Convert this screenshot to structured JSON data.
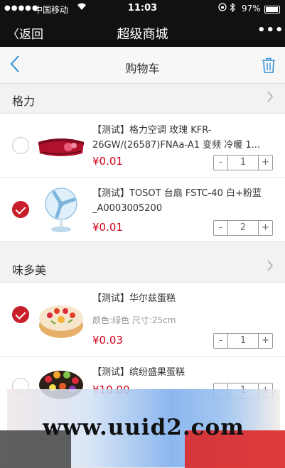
{
  "status_bar": {
    "signal": "●●●●●",
    "carrier": "中国移动",
    "wifi_icon": "wifi-icon",
    "time": "11:03",
    "battery": "97%"
  },
  "wechat_bar": {
    "back_label": "〈返回",
    "title": "超级商城",
    "more_label": "•••"
  },
  "header": {
    "title": "购物车",
    "back_icon": "chevron-left-icon",
    "delete_icon": "trash-icon"
  },
  "stores": [
    {
      "name": "格力",
      "items": [
        {
          "name": "【测试】格力空调 玫瑰 KFR-26GW/(26587)FNAa-A1 变频 冷暖 1...",
          "spec": "",
          "price": "¥0.01",
          "qty": "1",
          "checked": false
        },
        {
          "name": "【测试】TOSOT 台扇 FSTC-40 白+粉蓝_A0003005200",
          "spec": "",
          "price": "¥0.01",
          "qty": "2",
          "checked": true
        }
      ]
    },
    {
      "name": "味多美",
      "items": [
        {
          "name": "【测试】华尔兹蛋糕",
          "spec": "颜色:绿色  尺寸:25cm",
          "price": "¥0.03",
          "qty": "1",
          "checked": true
        },
        {
          "name": "【测试】缤纷盛果蛋糕",
          "spec": "",
          "price": "¥10.00",
          "qty": "1",
          "checked": false
        }
      ]
    }
  ],
  "stepper": {
    "minus": "-",
    "plus": "+"
  },
  "watermark": "www.uuid2.com",
  "colors": {
    "accent": "#2e8fd6",
    "price": "#d0021b",
    "checked": "#c81e2a"
  }
}
